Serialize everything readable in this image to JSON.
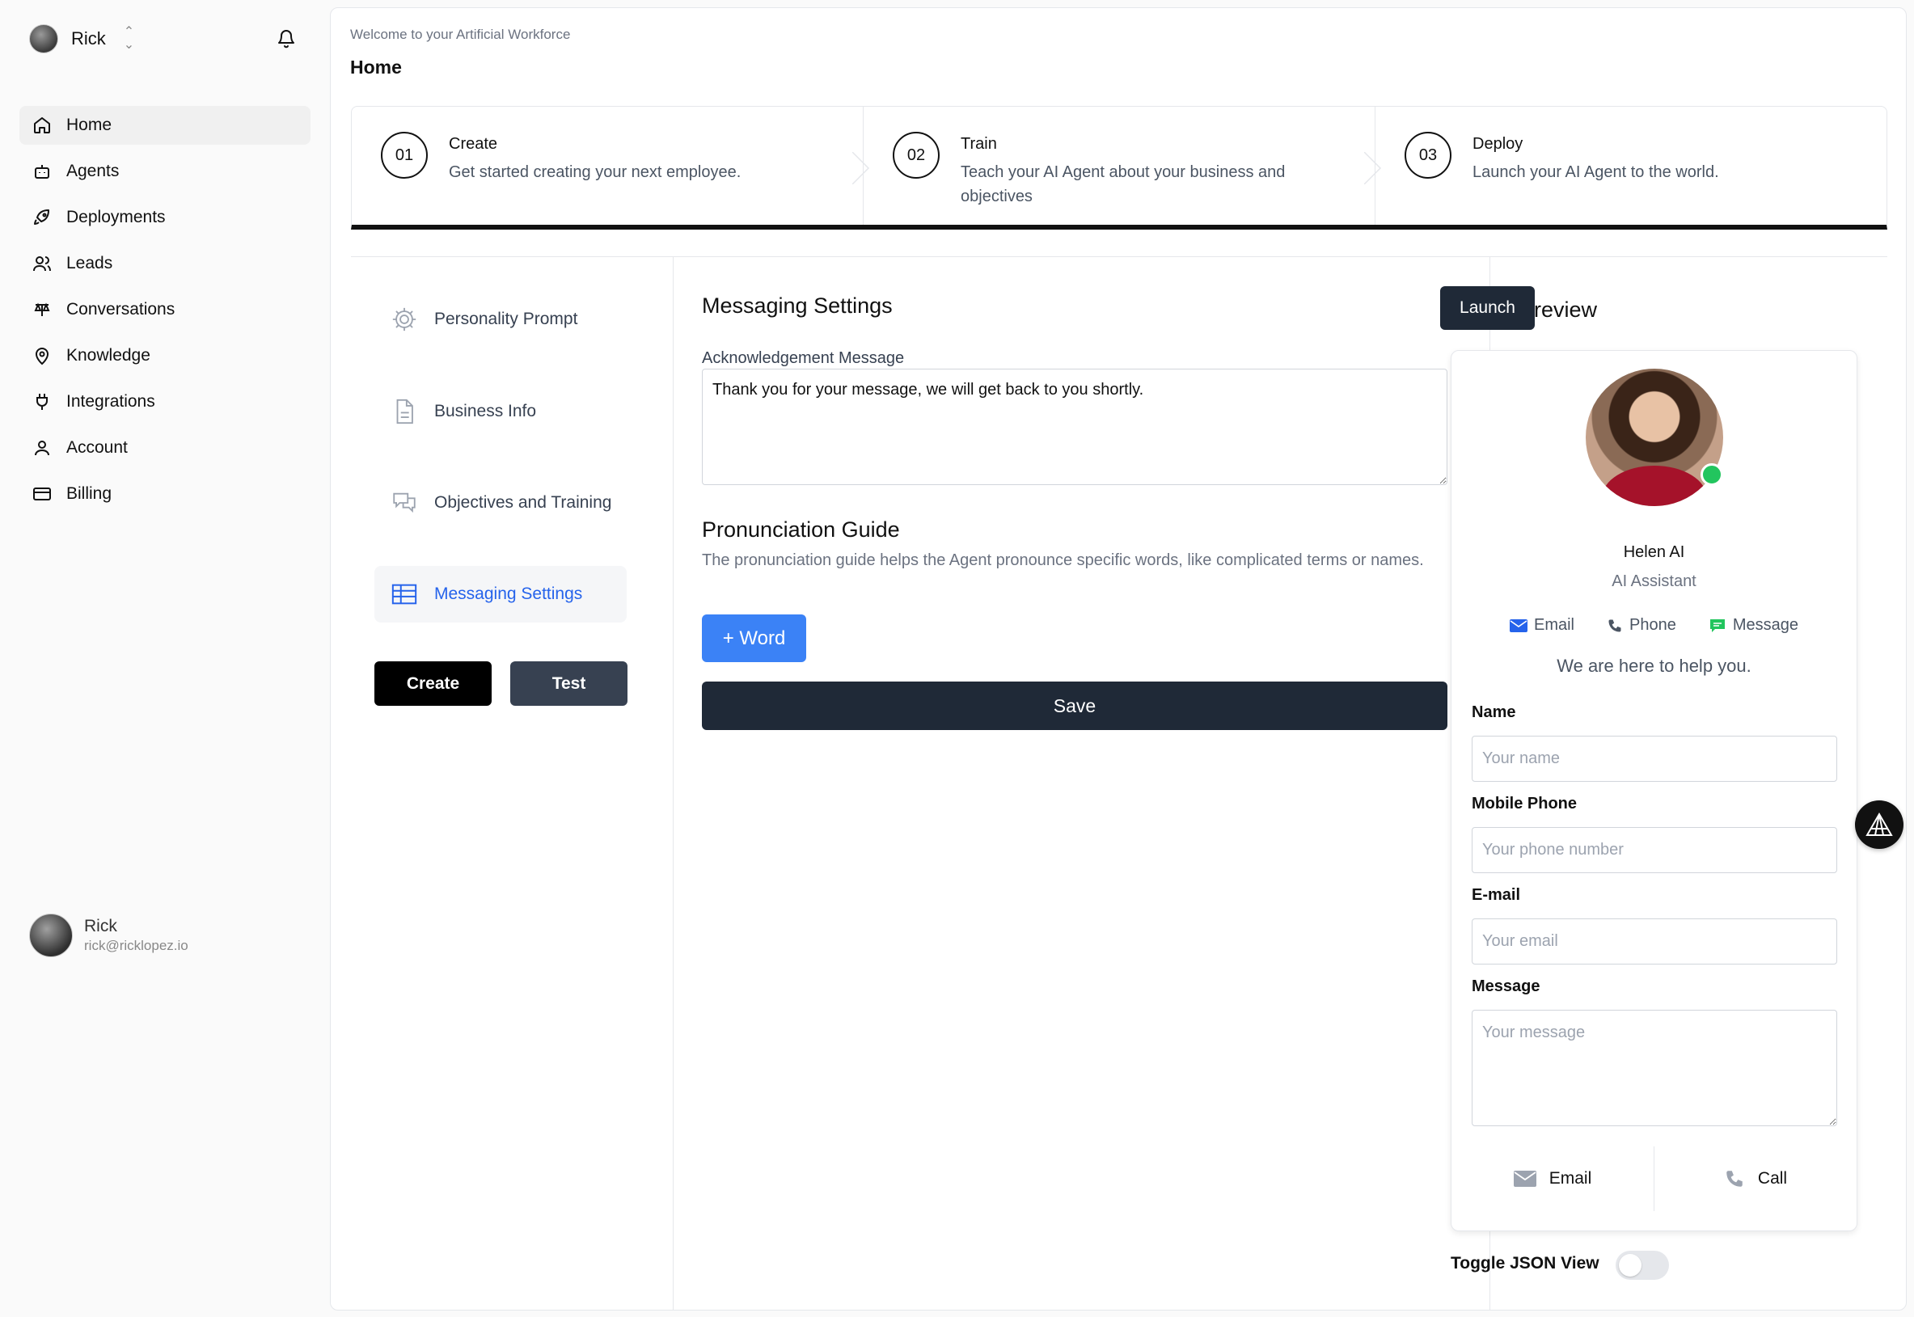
{
  "user": {
    "name": "Rick",
    "email": "rick@ricklopez.io"
  },
  "sidebar": {
    "items": [
      {
        "label": "Home",
        "icon": "home-icon",
        "active": true
      },
      {
        "label": "Agents",
        "icon": "bot-icon"
      },
      {
        "label": "Deployments",
        "icon": "rocket-icon"
      },
      {
        "label": "Leads",
        "icon": "users-icon"
      },
      {
        "label": "Conversations",
        "icon": "conversations-icon"
      },
      {
        "label": "Knowledge",
        "icon": "map-pin-icon"
      },
      {
        "label": "Integrations",
        "icon": "plug-icon"
      },
      {
        "label": "Account",
        "icon": "user-icon"
      },
      {
        "label": "Billing",
        "icon": "credit-card-icon"
      }
    ]
  },
  "header": {
    "welcome": "Welcome to your Artificial Workforce",
    "title": "Home"
  },
  "steps": [
    {
      "num": "01",
      "title": "Create",
      "desc": "Get started creating your next employee."
    },
    {
      "num": "02",
      "title": "Train",
      "desc": "Teach your AI Agent about your business and objectives"
    },
    {
      "num": "03",
      "title": "Deploy",
      "desc": "Launch your AI Agent to the world."
    }
  ],
  "tabs": [
    {
      "label": "Personality Prompt",
      "icon": "gear-icon"
    },
    {
      "label": "Business Info",
      "icon": "document-icon"
    },
    {
      "label": "Objectives and Training",
      "icon": "chat-bubbles-icon"
    },
    {
      "label": "Messaging Settings",
      "icon": "table-icon",
      "active": true
    }
  ],
  "actions": {
    "create": "Create",
    "test": "Test"
  },
  "messaging": {
    "title": "Messaging Settings",
    "ack_label": "Acknowledgement Message",
    "ack_value": "Thank you for your message, we will get back to you shortly.",
    "pg_title": "Pronunciation Guide",
    "pg_desc": "The pronunciation guide helps the Agent pronounce specific words, like complicated terms or names.",
    "word_button": "+ Word",
    "save_button": "Save"
  },
  "preview": {
    "title": "Preview",
    "launch_button": "Launch",
    "agent_name": "Helen AI",
    "agent_role": "AI Assistant",
    "contacts": {
      "email": "Email",
      "phone": "Phone",
      "message": "Message"
    },
    "help_text": "We are here to help you.",
    "form": {
      "name_label": "Name",
      "name_placeholder": "Your name",
      "phone_label": "Mobile Phone",
      "phone_placeholder": "Your phone number",
      "email_label": "E-mail",
      "email_placeholder": "Your email",
      "message_label": "Message",
      "message_placeholder": "Your message"
    },
    "footer": {
      "email": "Email",
      "call": "Call"
    },
    "toggle_label": "Toggle JSON View",
    "toggle_on": false
  },
  "colors": {
    "accent": "#3b82f6",
    "dark": "#1f2937",
    "active_tab": "#2563eb",
    "online": "#22c55e"
  }
}
